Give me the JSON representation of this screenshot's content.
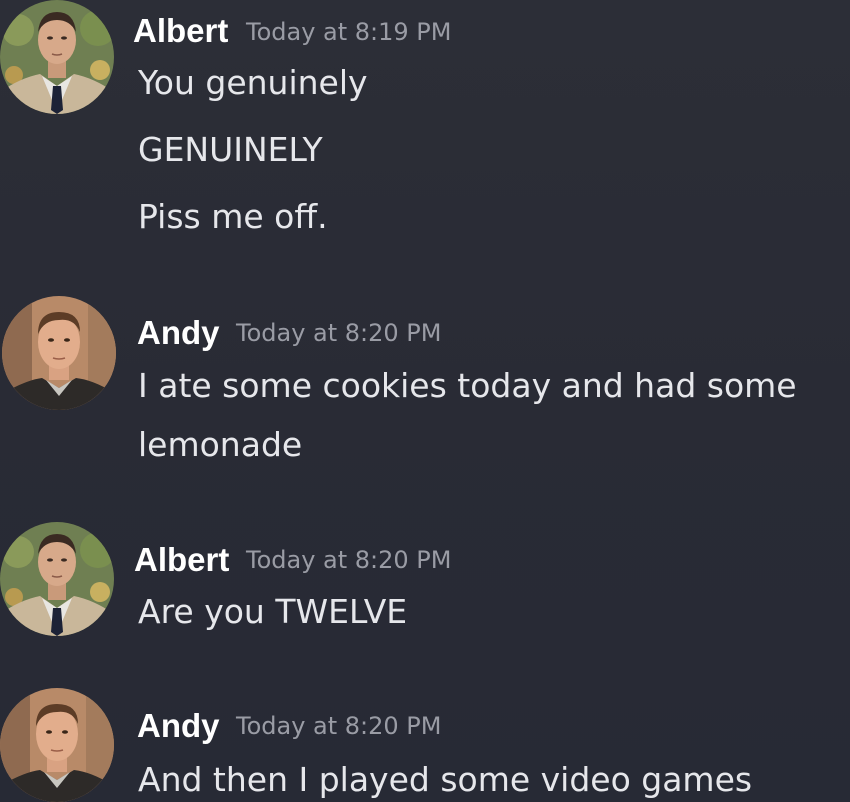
{
  "messages": [
    {
      "author": "Albert",
      "timestamp": "Today at 8:19 PM",
      "avatar_icon": "albert-avatar",
      "lines": [
        "You genuinely",
        "GENUINELY",
        "Piss me off."
      ]
    },
    {
      "author": "Andy",
      "timestamp": "Today at 8:20 PM",
      "avatar_icon": "andy-avatar",
      "lines": [
        "I ate some cookies today and had some",
        "lemonade"
      ]
    },
    {
      "author": "Albert",
      "timestamp": "Today at 8:20 PM",
      "avatar_icon": "albert-avatar",
      "lines": [
        "Are you TWELVE"
      ]
    },
    {
      "author": "Andy",
      "timestamp": "Today at 8:20 PM",
      "avatar_icon": "andy-avatar",
      "lines": [
        "And then I played some video games"
      ]
    }
  ],
  "colors": {
    "background": "#2a2c36",
    "author": "#ffffff",
    "timestamp": "#9a9ca5",
    "message_text": "#e6e7eb"
  }
}
